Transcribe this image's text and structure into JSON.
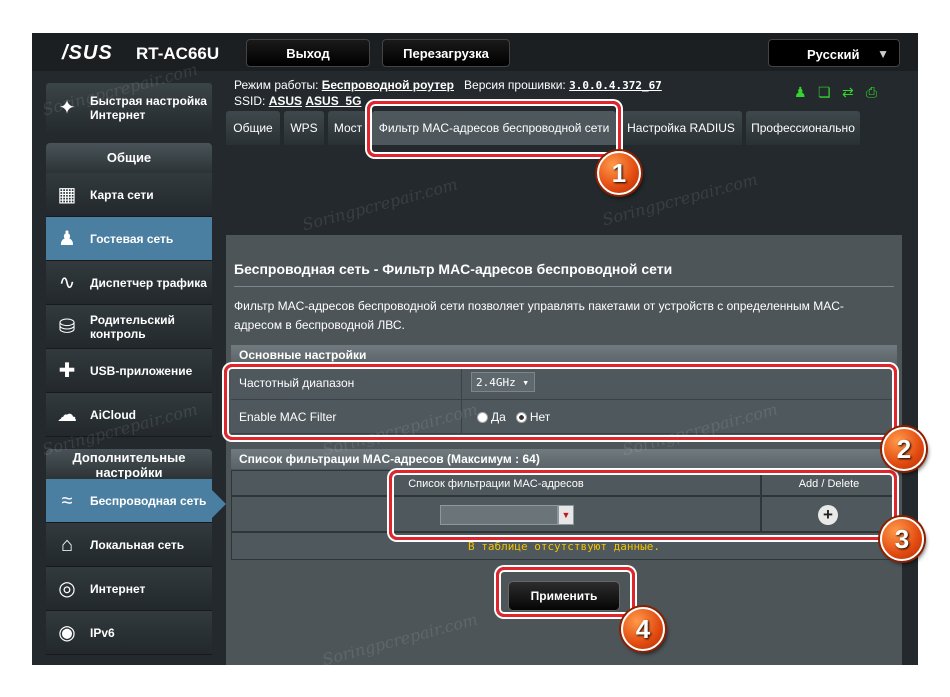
{
  "header": {
    "brand": "/SUS",
    "model": "RT-AC66U",
    "logout_label": "Выход",
    "reboot_label": "Перезагрузка",
    "language": "Русский"
  },
  "info": {
    "mode_label": "Режим работы:",
    "mode_value": "Беспроводной роутер",
    "firmware_label": "Версия прошивки:",
    "firmware_value": "3.0.0.4.372_67",
    "ssid_label": "SSID:",
    "ssid_1": "ASUS",
    "ssid_2": "ASUS_5G"
  },
  "sidebar": {
    "quick_setup": "Быстрая настройка Интернет",
    "general_header": "Общие",
    "items": [
      {
        "label": "Карта сети",
        "icon": "network-map-icon"
      },
      {
        "label": "Гостевая сеть",
        "icon": "guest-network-icon"
      },
      {
        "label": "Диспетчер трафика",
        "icon": "traffic-icon"
      },
      {
        "label": "Родительский контроль",
        "icon": "lock-icon"
      },
      {
        "label": "USB-приложение",
        "icon": "puzzle-icon"
      },
      {
        "label": "AiCloud",
        "icon": "cloud-icon"
      }
    ],
    "advanced_header": "Дополнительные настройки",
    "advanced_items": [
      {
        "label": "Беспроводная сеть",
        "icon": "wifi-icon"
      },
      {
        "label": "Локальная сеть",
        "icon": "home-icon"
      },
      {
        "label": "Интернет",
        "icon": "globe-icon"
      },
      {
        "label": "IPv6",
        "icon": "ipv6-icon"
      }
    ]
  },
  "tabs": [
    {
      "label": "Общие"
    },
    {
      "label": "WPS"
    },
    {
      "label": "Мост"
    },
    {
      "label": "Фильтр MAC-адресов беспроводной сети"
    },
    {
      "label": "Настройка RADIUS"
    },
    {
      "label": "Профессионально"
    }
  ],
  "main": {
    "title": "Беспроводная сеть - Фильтр MAC-адресов беспроводной сети",
    "description": "Фильтр MAC-адресов беспроводной сети позволяет управлять пакетами от устройств с определенным MAC-адресом в беспроводной ЛВС.",
    "basic_header": "Основные настройки",
    "band_label": "Частотный диапазон",
    "band_value": "2.4GHz ▾",
    "mac_filter_label": "Enable MAC Filter",
    "mac_filter_yes": "Да",
    "mac_filter_no": "Нет",
    "mac_filter_selected": "Нет",
    "list_header": "Список фильтрации MAC-адресов (Максимум : 64)",
    "col_list": "Список фильтрации MAC-адресов",
    "col_add_delete": "Add / Delete",
    "no_data": "В таблице отсутствуют данные.",
    "apply_label": "Применить"
  },
  "annotations": {
    "badge_1": "1",
    "badge_2": "2",
    "badge_3": "3",
    "badge_4": "4",
    "watermark": "Soringpcrepair.com",
    "color": "#e0262c"
  }
}
